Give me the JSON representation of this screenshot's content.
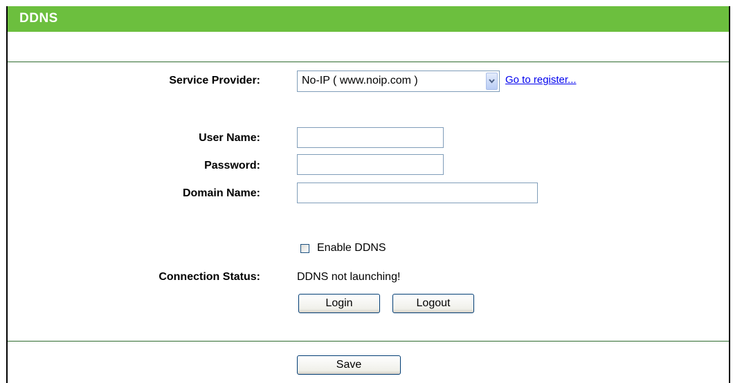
{
  "header": {
    "title": "DDNS"
  },
  "form": {
    "service_provider_label": "Service Provider:",
    "service_provider_value": "No-IP ( www.noip.com )",
    "register_link": "Go to register...",
    "username_label": "User Name:",
    "username_value": "",
    "password_label": "Password:",
    "password_value": "",
    "domain_label": "Domain Name:",
    "domain_value": "",
    "enable_label": "Enable DDNS",
    "enable_checked": false,
    "status_label": "Connection Status:",
    "status_value": "DDNS not launching!",
    "login_button": "Login",
    "logout_button": "Logout"
  },
  "footer": {
    "save_button": "Save"
  }
}
